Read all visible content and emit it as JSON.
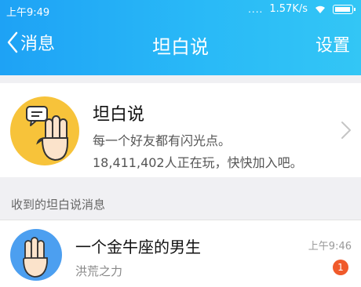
{
  "status_bar": {
    "time": "上午9:49",
    "dots": "....",
    "network_speed": "1.57K/s",
    "battery_level": 0.9
  },
  "nav": {
    "back_label": "消息",
    "title": "坦白说",
    "settings_label": "设置"
  },
  "promo": {
    "title": "坦白说",
    "subtitle": "每一个好友都有闪光点。",
    "stats": "18,411,402人正在玩，快快加入吧。",
    "icon": "hand-with-speech-bubble-icon"
  },
  "section": {
    "label": "收到的坦白说消息"
  },
  "messages": [
    {
      "title": "一个金牛座的男生",
      "subtitle": "洪荒之力",
      "time": "上午9:46",
      "badge": "1",
      "avatar": "hand-gesture-avatar-icon"
    }
  ],
  "colors": {
    "header_start": "#1ea2f5",
    "header_end": "#33c6f5",
    "promo_icon_bg": "#f7c33a",
    "avatar_bg": "#4c9ff0",
    "badge": "#f05a2b"
  }
}
